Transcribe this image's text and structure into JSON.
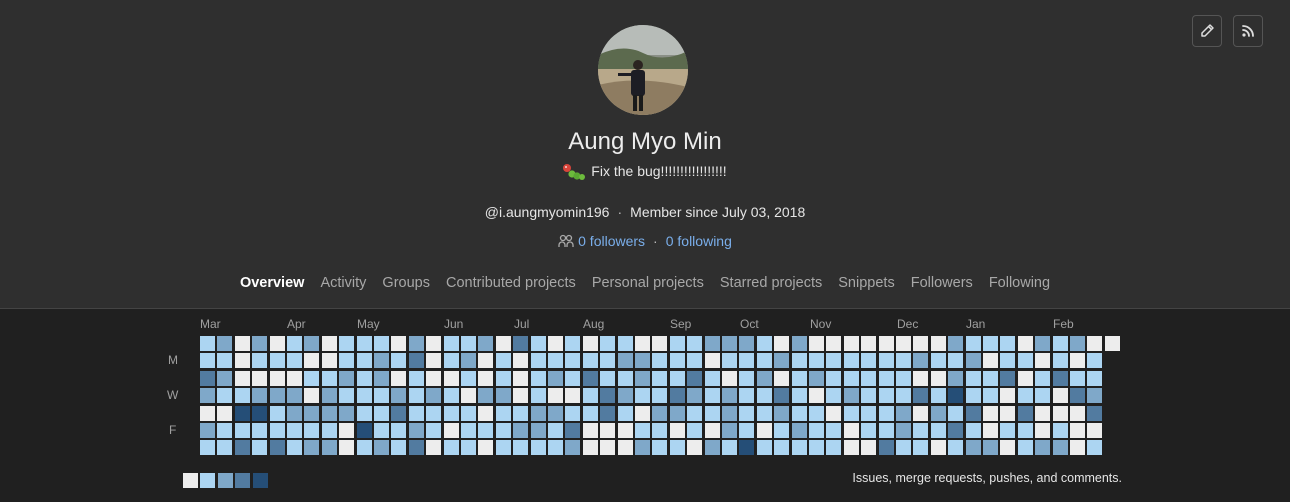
{
  "profile": {
    "name": "Aung Myo Min",
    "status_text": "Fix the bug!!!!!!!!!!!!!!!!!",
    "username": "@i.aungmyomin196",
    "member_since": "Member since July 03, 2018",
    "followers": "0 followers",
    "following": "0 following",
    "separator": "·"
  },
  "actions": {
    "edit_icon": "pencil-icon",
    "rss_icon": "rss-icon"
  },
  "tabs": [
    {
      "label": "Overview",
      "active": true
    },
    {
      "label": "Activity"
    },
    {
      "label": "Groups"
    },
    {
      "label": "Contributed projects"
    },
    {
      "label": "Personal projects"
    },
    {
      "label": "Starred projects"
    },
    {
      "label": "Snippets"
    },
    {
      "label": "Followers"
    },
    {
      "label": "Following"
    }
  ],
  "calendar": {
    "months": [
      "Mar",
      "Apr",
      "May",
      "Jun",
      "Jul",
      "Aug",
      "Sep",
      "Oct",
      "Nov",
      "Dec",
      "Jan",
      "Feb"
    ],
    "day_labels": [
      "M",
      "W",
      "F"
    ],
    "legend_text": "Issues, merge requests, pushes, and comments.",
    "colors": [
      "#ededed",
      "#acd5f2",
      "#7fa8c9",
      "#527ba0",
      "#254e77"
    ],
    "weeks": 53,
    "seed": 1
  }
}
